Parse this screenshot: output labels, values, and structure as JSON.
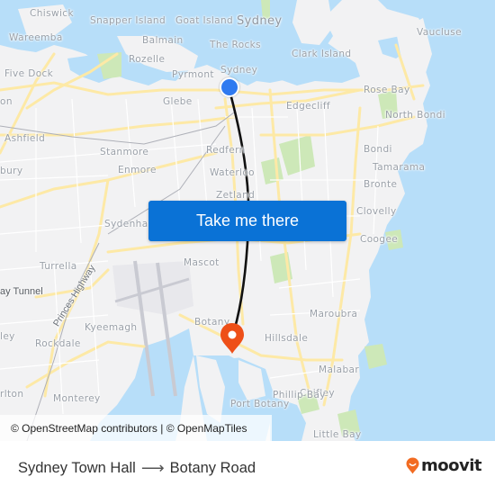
{
  "map": {
    "places": [
      {
        "name": "Chiswick",
        "cls": ""
      },
      {
        "name": "Snapper Island",
        "cls": ""
      },
      {
        "name": "Goat Island",
        "cls": ""
      },
      {
        "name": "Sydney",
        "cls": "big"
      },
      {
        "name": "Vaucluse",
        "cls": ""
      },
      {
        "name": "Wareemba",
        "cls": ""
      },
      {
        "name": "Balmain",
        "cls": ""
      },
      {
        "name": "The Rocks",
        "cls": ""
      },
      {
        "name": "Clark Island",
        "cls": ""
      },
      {
        "name": "Rozelle",
        "cls": ""
      },
      {
        "name": "Five Dock",
        "cls": ""
      },
      {
        "name": "Pyrmont",
        "cls": ""
      },
      {
        "name": "Sydney",
        "cls": ""
      },
      {
        "name": "Rose Bay",
        "cls": ""
      },
      {
        "name": "on",
        "cls": ""
      },
      {
        "name": "Glebe",
        "cls": ""
      },
      {
        "name": "Edgecliff",
        "cls": ""
      },
      {
        "name": "North Bondi",
        "cls": ""
      },
      {
        "name": "Ashfield",
        "cls": ""
      },
      {
        "name": "Redfern",
        "cls": ""
      },
      {
        "name": "Stanmore",
        "cls": ""
      },
      {
        "name": "Bondi",
        "cls": ""
      },
      {
        "name": "Enmore",
        "cls": ""
      },
      {
        "name": "Waterloo",
        "cls": ""
      },
      {
        "name": "bury",
        "cls": ""
      },
      {
        "name": "Tamarama",
        "cls": ""
      },
      {
        "name": "Bronte",
        "cls": ""
      },
      {
        "name": "Zetland",
        "cls": ""
      },
      {
        "name": "Clovelly",
        "cls": ""
      },
      {
        "name": "Sydenham",
        "cls": ""
      },
      {
        "name": "Coogee",
        "cls": ""
      },
      {
        "name": "Mascot",
        "cls": ""
      },
      {
        "name": "Turrella",
        "cls": ""
      },
      {
        "name": "ay Tunnel",
        "cls": "dark"
      },
      {
        "name": "Princes Highway",
        "cls": "rot"
      },
      {
        "name": "Maroubra",
        "cls": ""
      },
      {
        "name": "Botany",
        "cls": ""
      },
      {
        "name": "Kyeemagh",
        "cls": ""
      },
      {
        "name": "ley",
        "cls": ""
      },
      {
        "name": "Hillsdale",
        "cls": ""
      },
      {
        "name": "Rockdale",
        "cls": ""
      },
      {
        "name": "Malabar",
        "cls": ""
      },
      {
        "name": "rlton",
        "cls": ""
      },
      {
        "name": "Chifley",
        "cls": ""
      },
      {
        "name": "Monterey",
        "cls": ""
      },
      {
        "name": "Port Botany",
        "cls": ""
      },
      {
        "name": "Phillip Bay",
        "cls": ""
      },
      {
        "name": "Little Bay",
        "cls": ""
      }
    ],
    "origin_icon": "origin-dot-icon",
    "destination_icon": "destination-pin-icon",
    "cta_label": "Take me there",
    "attribution": "© OpenStreetMap contributors | © OpenMapTiles",
    "colors": {
      "water": "#b7def9",
      "land": "#f2f2f3",
      "road_major": "#fde9a6",
      "park": "#cde8b8",
      "route": "#111111",
      "origin": "#2f7af0",
      "destination": "#ee4f18",
      "cta": "#0a72d6"
    }
  },
  "footer": {
    "origin": "Sydney Town Hall",
    "arrow_icon": "arrow-right-icon",
    "arrow": "⟶",
    "destination": "Botany Road",
    "brand": "moovit",
    "brand_icon": "moovit-pin-icon",
    "brand_color": "#f26b21"
  }
}
